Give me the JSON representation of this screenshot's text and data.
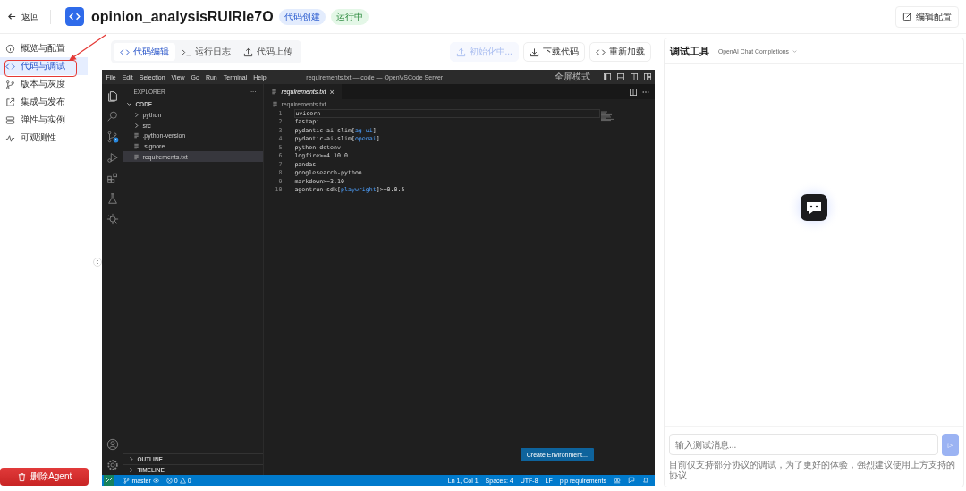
{
  "header": {
    "back": "返回",
    "title": "opinion_analysisRUIRle7O",
    "badges": [
      {
        "label": "代码创建",
        "kind": "source"
      },
      {
        "label": "运行中",
        "kind": "status"
      }
    ],
    "edit_button": "编辑配置"
  },
  "sidebar": {
    "items": [
      {
        "label": "概览与配置",
        "selected": false
      },
      {
        "label": "代码与调试",
        "selected": true
      },
      {
        "label": "版本与灰度",
        "selected": false
      },
      {
        "label": "集成与发布",
        "selected": false
      },
      {
        "label": "弹性与实例",
        "selected": false
      },
      {
        "label": "可观测性",
        "selected": false
      }
    ],
    "delete_button": "删除Agent"
  },
  "toolbar": {
    "tabs": [
      {
        "label": "代码编辑",
        "selected": true
      },
      {
        "label": "运行日志",
        "selected": false
      },
      {
        "label": "代码上传",
        "selected": false
      }
    ],
    "buttons": [
      {
        "label": "初始化中...",
        "disabled": true
      },
      {
        "label": "下载代码",
        "disabled": false
      },
      {
        "label": "重新加载",
        "disabled": false
      }
    ]
  },
  "editor_window": {
    "menu": [
      "File",
      "Edit",
      "Selection",
      "View",
      "Go",
      "Run",
      "Terminal",
      "Help"
    ],
    "title": "requirements.txt — code — OpenVSCode Server",
    "fullscreen": "全屏模式",
    "explorer": {
      "title": "EXPLORER",
      "more": "···",
      "tree": [
        {
          "label": "CODE",
          "kind": "folder",
          "expanded": true,
          "selected": false,
          "children": [
            {
              "label": "python",
              "kind": "folder",
              "expanded": false,
              "selected": false
            },
            {
              "label": "src",
              "kind": "folder",
              "expanded": false,
              "selected": false
            },
            {
              "label": ".python-version",
              "kind": "file",
              "selected": false
            },
            {
              "label": ".signore",
              "kind": "file",
              "selected": false
            },
            {
              "label": "requirements.txt",
              "kind": "file",
              "selected": true
            }
          ]
        }
      ],
      "sections": [
        "OUTLINE",
        "TIMELINE"
      ]
    },
    "tab": {
      "label": "requirements.txt",
      "close": "×"
    },
    "breadcrumb": "requirements.txt",
    "lines": [
      {
        "number": "1",
        "parts": [
          {
            "text": "uvicorn",
            "kind": "plain"
          }
        ]
      },
      {
        "number": "2",
        "parts": [
          {
            "text": "fastapi",
            "kind": "plain"
          }
        ]
      },
      {
        "number": "3",
        "parts": [
          {
            "text": "pydantic-ai-slim[",
            "kind": "plain"
          },
          {
            "text": "ag-ui",
            "kind": "extra"
          },
          {
            "text": "]",
            "kind": "plain"
          }
        ]
      },
      {
        "number": "4",
        "parts": [
          {
            "text": "pydantic-ai-slim[",
            "kind": "plain"
          },
          {
            "text": "openai",
            "kind": "extra"
          },
          {
            "text": "]",
            "kind": "plain"
          }
        ]
      },
      {
        "number": "5",
        "parts": [
          {
            "text": "python-dotenv",
            "kind": "plain"
          }
        ]
      },
      {
        "number": "6",
        "parts": [
          {
            "text": "logfire>=4.10.0",
            "kind": "plain"
          }
        ]
      },
      {
        "number": "7",
        "parts": [
          {
            "text": "pandas",
            "kind": "plain"
          }
        ]
      },
      {
        "number": "8",
        "parts": [
          {
            "text": "googlesearch-python",
            "kind": "plain"
          }
        ]
      },
      {
        "number": "9",
        "parts": [
          {
            "text": "markdown>=3.10",
            "kind": "plain"
          }
        ]
      },
      {
        "number": "10",
        "parts": [
          {
            "text": "agentrun-sdk[",
            "kind": "plain"
          },
          {
            "text": "playwright",
            "kind": "extra"
          },
          {
            "text": "]>=0.0.5",
            "kind": "plain"
          }
        ]
      }
    ],
    "create_button": "Create Environment...",
    "status_bar": {
      "branch": "master",
      "errors": "0",
      "warnings": "0",
      "items": [
        "Ln 1, Col 1",
        "Spaces: 4",
        "UTF-8",
        "LF",
        "pip requirements"
      ]
    }
  },
  "debug_panel": {
    "title": "调试工具",
    "protocol": "OpenAI Chat Completions",
    "input": {
      "placeholder": "输入测试消息..."
    },
    "send": "▷",
    "send_disabled": true,
    "hint": "目前仅支持部分协议的调试，为了更好的体验，强烈建议使用上方支持的协议"
  }
}
